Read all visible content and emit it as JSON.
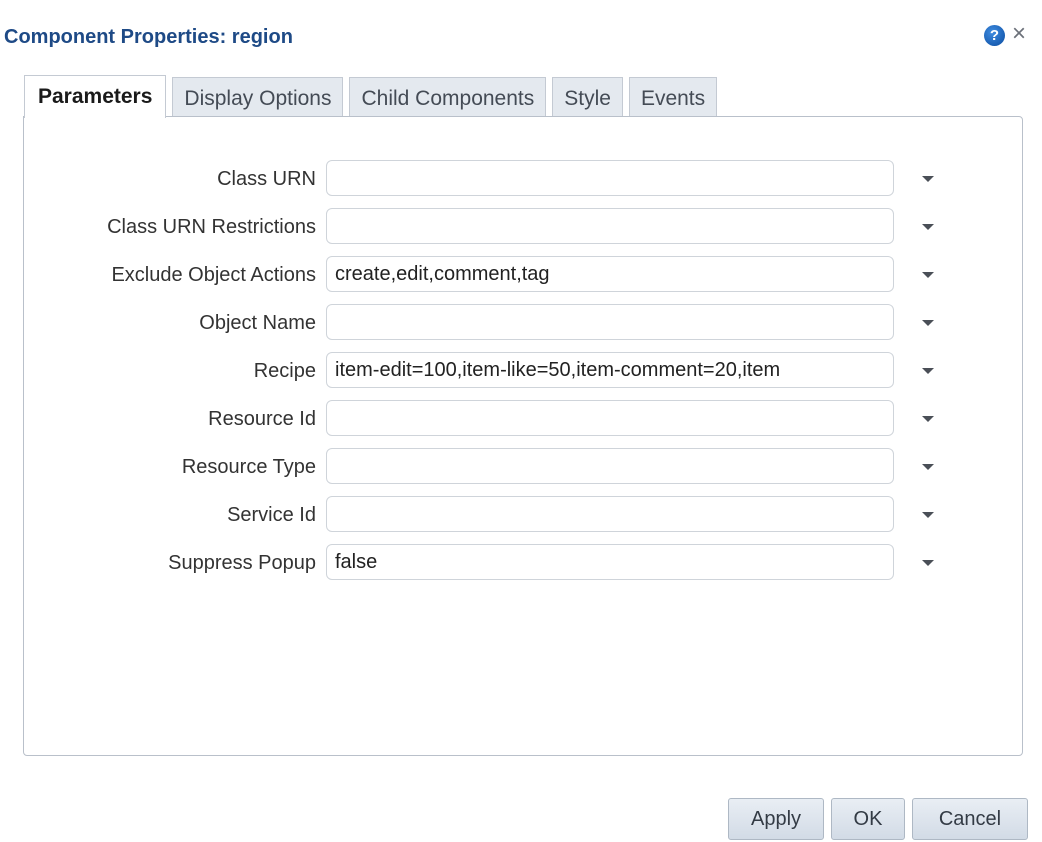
{
  "dialog": {
    "title": "Component Properties: region",
    "help_icon": "help-icon",
    "help_glyph": "?",
    "close_icon": "close-icon",
    "close_glyph": "×"
  },
  "tabs": [
    {
      "label": "Parameters",
      "active": true
    },
    {
      "label": "Display Options",
      "active": false
    },
    {
      "label": "Child Components",
      "active": false
    },
    {
      "label": "Style",
      "active": false
    },
    {
      "label": "Events",
      "active": false
    }
  ],
  "fields": [
    {
      "label": "Class URN",
      "value": ""
    },
    {
      "label": "Class URN Restrictions",
      "value": ""
    },
    {
      "label": "Exclude Object Actions",
      "value": "create,edit,comment,tag"
    },
    {
      "label": "Object Name",
      "value": ""
    },
    {
      "label": "Recipe",
      "value": "item-edit=100,item-like=50,item-comment=20,item"
    },
    {
      "label": "Resource Id",
      "value": ""
    },
    {
      "label": "Resource Type",
      "value": ""
    },
    {
      "label": "Service Id",
      "value": ""
    },
    {
      "label": "Suppress Popup",
      "value": "false"
    }
  ],
  "buttons": {
    "apply": "Apply",
    "ok": "OK",
    "cancel": "Cancel"
  },
  "colors": {
    "title": "#1e4a86",
    "tab_inactive_bg": "#e4e9ef",
    "border": "#b9c0ca"
  }
}
